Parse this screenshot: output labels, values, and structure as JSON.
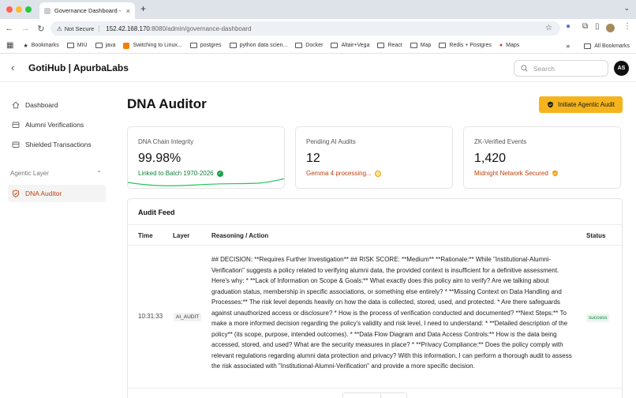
{
  "browser": {
    "tab_title": "Governance Dashboard - GotiHub",
    "tab_close": "×",
    "new_tab": "+",
    "security_label": "Not Secure",
    "url_host": "152.42.168.170",
    "url_path": ":8080/admin/governance-dashboard",
    "bookmarks": [
      "Bookmarks",
      "MIU",
      "java",
      "Switching to Linux...",
      "postgres",
      "python data scien...",
      "Docker",
      "Altair+Vega",
      "React",
      "Map",
      "Redis + Postgres",
      "Maps"
    ],
    "all_bookmarks": "All Bookmarks",
    "more_bookmarks": "»",
    "colors": {
      "tabbar": "#dee3ea",
      "close": "#ff5f57",
      "minimize": "#febc2e",
      "maximize": "#28c840"
    }
  },
  "header": {
    "brand": "GotiHub | ApurbaLabs",
    "search_placeholder": "Search",
    "avatar_initials": "AS"
  },
  "sidebar": {
    "items": [
      {
        "label": "Dashboard",
        "icon": "home-icon"
      },
      {
        "label": "Alumni Verifications",
        "icon": "database-icon"
      },
      {
        "label": "Shielded Transactions",
        "icon": "database-icon"
      }
    ],
    "section_label": "Agentic Layer",
    "section_items": [
      {
        "label": "DNA Auditor",
        "icon": "shield-icon",
        "active": true
      }
    ]
  },
  "main": {
    "title": "DNA Auditor",
    "cta_label": "Initiate Agentic Audit",
    "cards": [
      {
        "label": "DNA Chain Integrity",
        "value": "99.98%",
        "sub": "Linked to Batch 1970-2026",
        "sub_color": "#15803d",
        "sub_icon": "check-circle-icon"
      },
      {
        "label": "Pending AI Audits",
        "value": "12",
        "sub": "Gemma 4 processing...",
        "sub_color": "#c2410c",
        "sub_icon": "pending-dot-icon"
      },
      {
        "label": "ZK-Verified Events",
        "value": "1,420",
        "sub": "Midnight Network Secured",
        "sub_color": "#c2410c",
        "sub_icon": "shield-check-icon"
      }
    ],
    "feed": {
      "title": "Audit Feed",
      "columns": [
        "Time",
        "Layer",
        "Reasoning / Action",
        "Status"
      ],
      "rows": [
        {
          "time": "10:31:33",
          "layer": "AI_AUDIT",
          "reasoning": "## DECISION: **Requires Further Investigation** ## RISK SCORE: **Medium** **Rationale:** While \"Institutional-Alumni-Verification\" suggests a policy related to verifying alumni data, the provided context is insufficient for a definitive assessment. Here's why: * **Lack of Information on Scope & Goals:** What exactly does this policy aim to verify? Are we talking about graduation status, membership in specific associations, or something else entirely? * **Missing Context on Data Handling and Processes:** The risk level depends heavily on how the data is collected, stored, used, and protected. * Are there safeguards against unauthorized access or disclosure? * How is the process of verification conducted and documented? **Next Steps:** To make a more informed decision regarding the policy's validity and risk level, I need to understand: * **Detailed description of the policy** (its scope, purpose, intended outcomes). * **Data Flow Diagram and Data Access Controls:** How is the data being accessed, stored, and used? What are the security measures in place? * **Privacy Compliance:** Does the policy comply with relevant regulations regarding alumni data protection and privacy? With this information, I can perform a thorough audit to assess the risk associated with \"Institutional-Alumni-Verification\" and provide a more specific decision.",
          "status": "success"
        }
      ]
    }
  }
}
